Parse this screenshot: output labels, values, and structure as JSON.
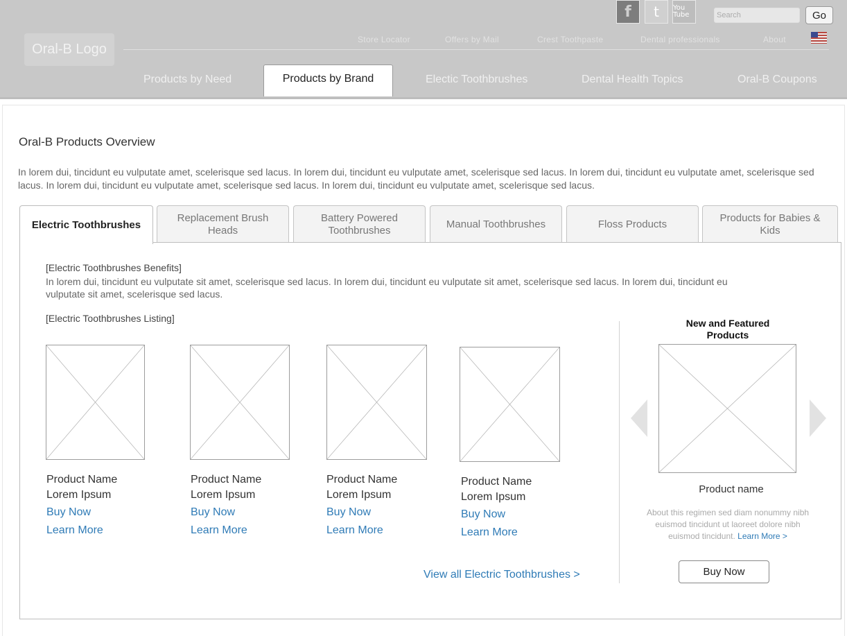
{
  "header": {
    "logo_text": "Oral-B Logo",
    "social": {
      "facebook": "f",
      "twitter": "t",
      "youtube": "You Tube"
    },
    "search": {
      "placeholder": "Search",
      "button": "Go"
    },
    "utility_links": [
      "Store Locator",
      "Offers by Mail",
      "Crest Toothpaste",
      "Dental professionals",
      "About"
    ],
    "flag_icon": "us-flag-icon",
    "nav": [
      "Products by Need",
      "Products by Brand",
      "Electic Toothbrushes",
      "Dental Health Topics",
      "Oral-B Coupons"
    ],
    "active_nav": "Products by Brand"
  },
  "main": {
    "title": "Oral-B Products Overview",
    "intro": "In lorem dui, tincidunt eu vulputate amet, scelerisque sed lacus. In lorem dui, tincidunt eu vulputate amet, scelerisque sed lacus. In lorem dui, tincidunt eu vulputate amet, scelerisque sed lacus. In lorem dui, tincidunt eu vulputate amet, scelerisque sed lacus. In lorem dui, tincidunt eu vulputate amet, scelerisque sed lacus.",
    "tabs": [
      "Electric Toothbrushes",
      "Replacement Brush Heads",
      "Battery Powered Toothbrushes",
      "Manual Toothbrushes",
      "Floss Products",
      "Products for Babies & Kids"
    ],
    "active_tab": "Electric Toothbrushes",
    "benefits_title": "[Electric Toothbrushes Benefits]",
    "benefits_text": "In lorem dui, tincidunt eu vulputate sit amet, scelerisque sed lacus. In lorem dui, tincidunt eu vulputate sit amet, scelerisque sed lacus. In lorem dui, tincidunt eu vulputate sit amet, scelerisque sed lacus.",
    "listing_title": "[Electric Toothbrushes Listing]",
    "products": [
      {
        "name": "Product Name",
        "subtitle": "Lorem Ipsum",
        "buy": "Buy Now",
        "learn": "Learn More"
      },
      {
        "name": "Product Name",
        "subtitle": "Lorem Ipsum",
        "buy": "Buy Now",
        "learn": "Learn More"
      },
      {
        "name": "Product Name",
        "subtitle": "Lorem Ipsum",
        "buy": "Buy Now",
        "learn": "Learn More"
      },
      {
        "name": "Product Name",
        "subtitle": "Lorem Ipsum",
        "buy": "Buy Now",
        "learn": "Learn More"
      }
    ],
    "view_all": "View all Electric Toothbrushes >"
  },
  "featured": {
    "title": "New and Featured Products",
    "product_name": "Product name",
    "description": "About this regimen sed diam nonummy nibh euismod tincidunt ut laoreet dolore nibh euismod tincidunt.",
    "learn_more": "Learn More >",
    "buy_button": "Buy Now"
  }
}
